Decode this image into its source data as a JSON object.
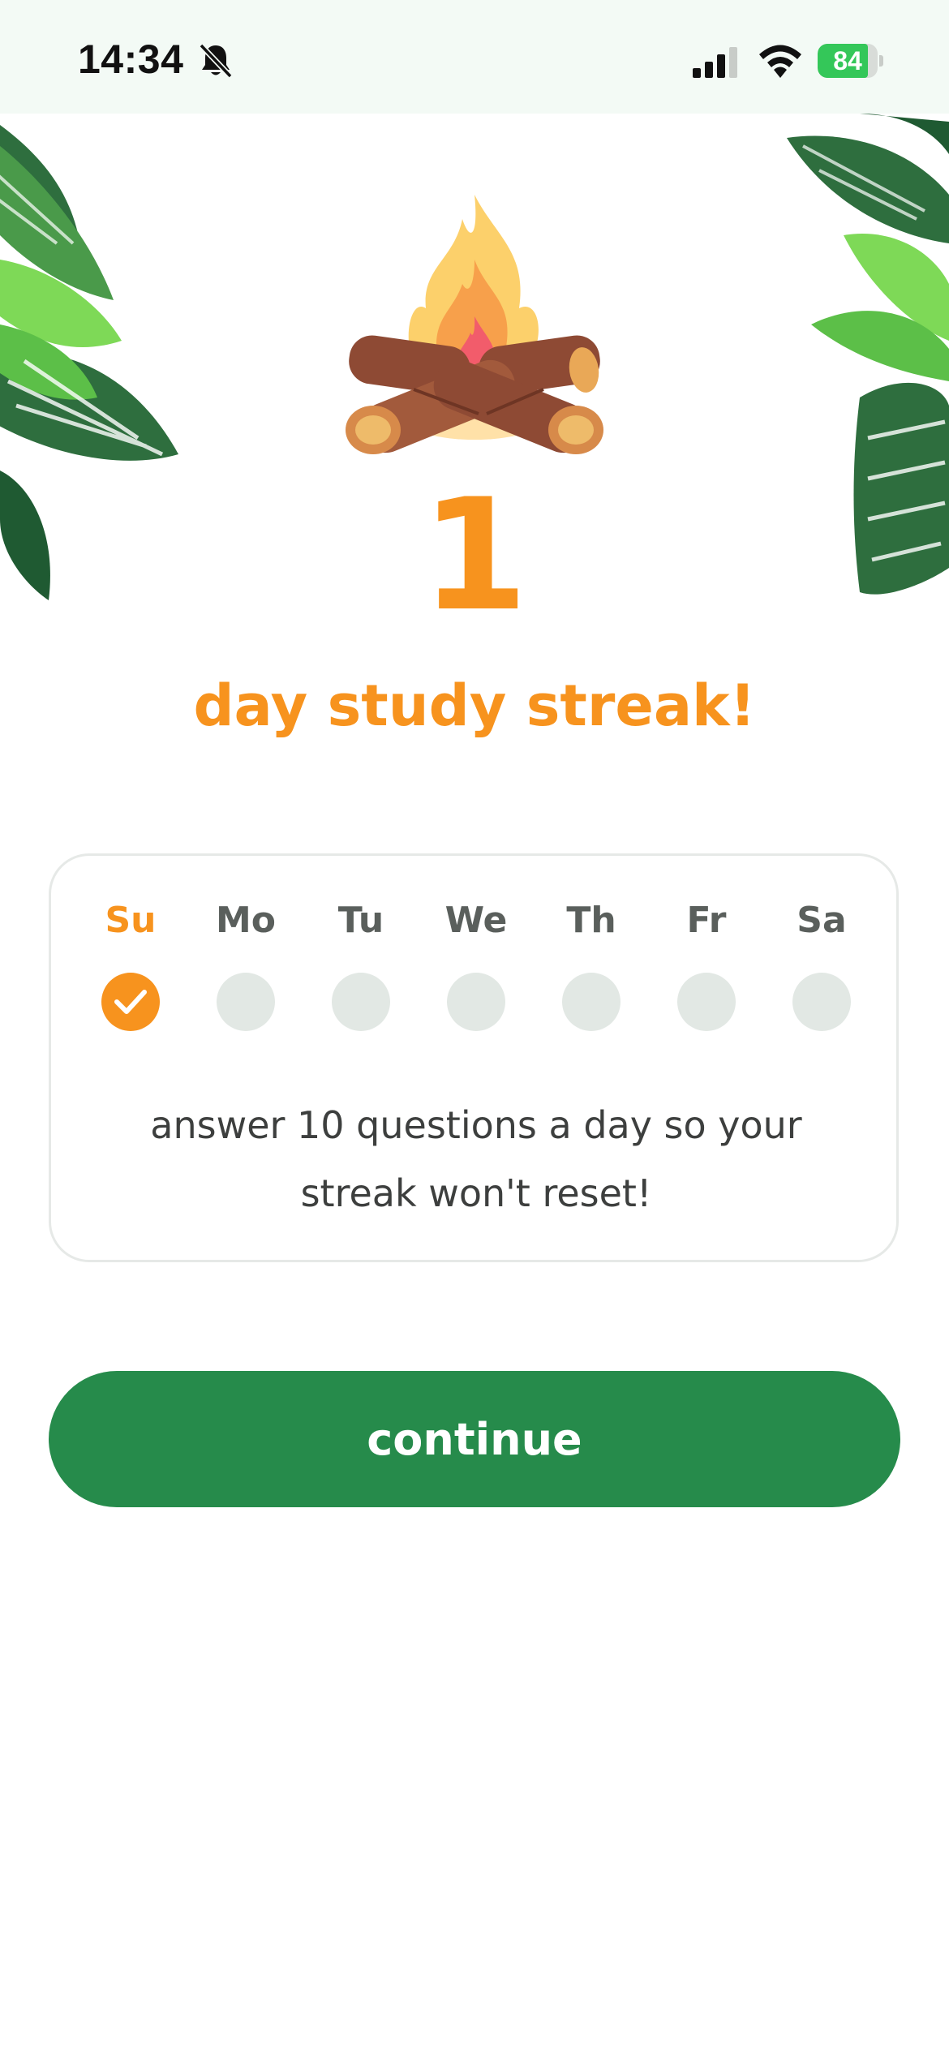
{
  "status_bar": {
    "time": "14:34",
    "battery": "84",
    "battery_level": 0.84,
    "icons": [
      "bell-slash-icon",
      "signal-icon",
      "wifi-icon",
      "battery-icon"
    ]
  },
  "streak": {
    "count": "1",
    "label": "day study streak!"
  },
  "week": {
    "days": [
      {
        "label": "Su",
        "done": true
      },
      {
        "label": "Mo",
        "done": false
      },
      {
        "label": "Tu",
        "done": false
      },
      {
        "label": "We",
        "done": false
      },
      {
        "label": "Th",
        "done": false
      },
      {
        "label": "Fr",
        "done": false
      },
      {
        "label": "Sa",
        "done": false
      }
    ],
    "message": "answer 10 questions a day so your streak won't reset!"
  },
  "actions": {
    "continue_label": "continue"
  },
  "colors": {
    "accent": "#f7931e",
    "primary_button": "#268b4b",
    "inactive_dot": "#e2e8e4",
    "leaf_dark": "#2e6e3e",
    "leaf_light": "#7ed957"
  }
}
